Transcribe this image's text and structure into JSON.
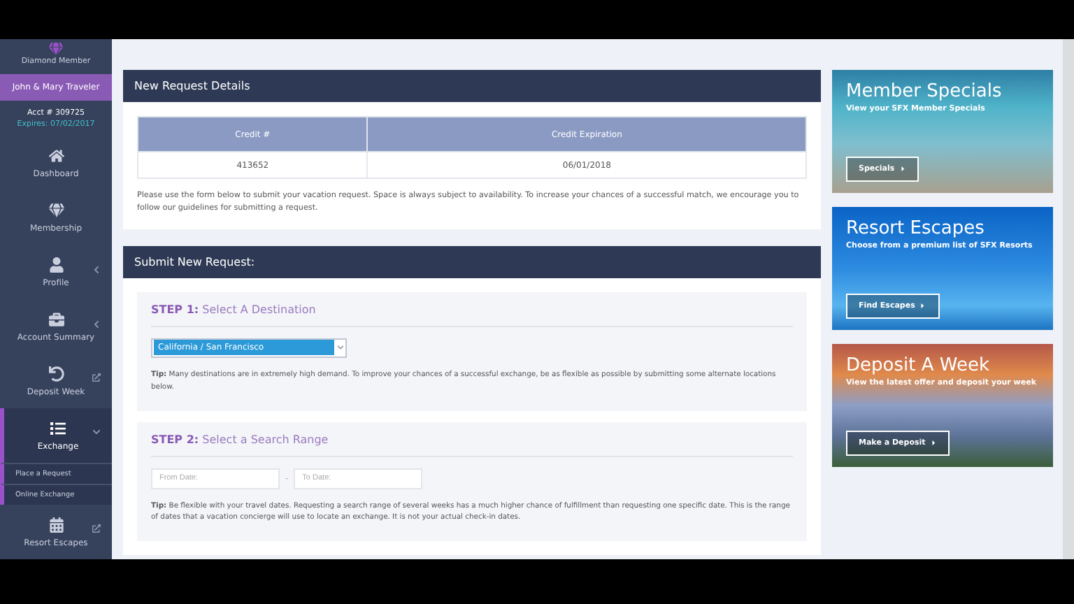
{
  "sidebar": {
    "member_level": "Diamond Member",
    "member_name": "John & Mary Traveler",
    "account": "Acct # 309725",
    "expires": "Expires: 07/02/2017",
    "items": [
      {
        "label": "Dashboard",
        "kind": "plain",
        "selected": false
      },
      {
        "label": "Membership",
        "kind": "plain",
        "selected": false
      },
      {
        "label": "Profile",
        "kind": "menu",
        "selected": false,
        "expanded": false
      },
      {
        "label": "Account Summary",
        "kind": "menu",
        "selected": false,
        "expanded": false
      },
      {
        "label": "Deposit Week",
        "kind": "link",
        "selected": false
      },
      {
        "label": "Exchange",
        "kind": "menu",
        "selected": true,
        "expanded": true,
        "children": [
          {
            "label": "Place a Request"
          },
          {
            "label": "Online Exchange"
          }
        ]
      },
      {
        "label": "Resort Escapes",
        "kind": "link",
        "selected": false
      }
    ]
  },
  "details": {
    "title": "New Request Details",
    "columns": [
      "Credit #",
      "Credit Expiration"
    ],
    "rows": [
      [
        "413652",
        "06/01/2018"
      ]
    ],
    "note": "Please use the form below to submit your vacation request. Space is always subject to availability. To increase your chances of a successful match, we encourage you to follow our guidelines for submitting a request."
  },
  "request": {
    "title": "Submit New Request:",
    "steps": [
      {
        "kind": "select",
        "heading": "**STEP 1:** Select A Destination",
        "value": "California / San Francisco",
        "tip": "**Tip:** Many destinations are in extremely high demand. To improve your chances of a successful exchange, be as flexible as possible by submitting some alternate locations below."
      },
      {
        "kind": "range",
        "heading": "**STEP 2:** Select a Search Range",
        "from_placeholder": "From Date:",
        "separator": "-",
        "to_placeholder": "To Date:",
        "tip": "**Tip:** Be flexible with your travel dates. Requesting a search range of several weeks has a much higher chance of fulfillment than requesting one specific date. This is the range of dates that a vacation concierge will use to locate an exchange. It is not your actual check-in dates."
      }
    ]
  },
  "promos": [
    {
      "kind": "beach",
      "title": "Member Specials",
      "subtitle": "View your SFX Member Specials",
      "button": "Specials"
    },
    {
      "kind": "tropical",
      "title": "Resort Escapes",
      "subtitle": "Choose from a premium list of SFX Resorts",
      "button": "Find Escapes"
    },
    {
      "kind": "mountains",
      "title": "Deposit A Week",
      "subtitle": "View the latest offer and deposit your week",
      "button": "Make a Deposit"
    }
  ]
}
